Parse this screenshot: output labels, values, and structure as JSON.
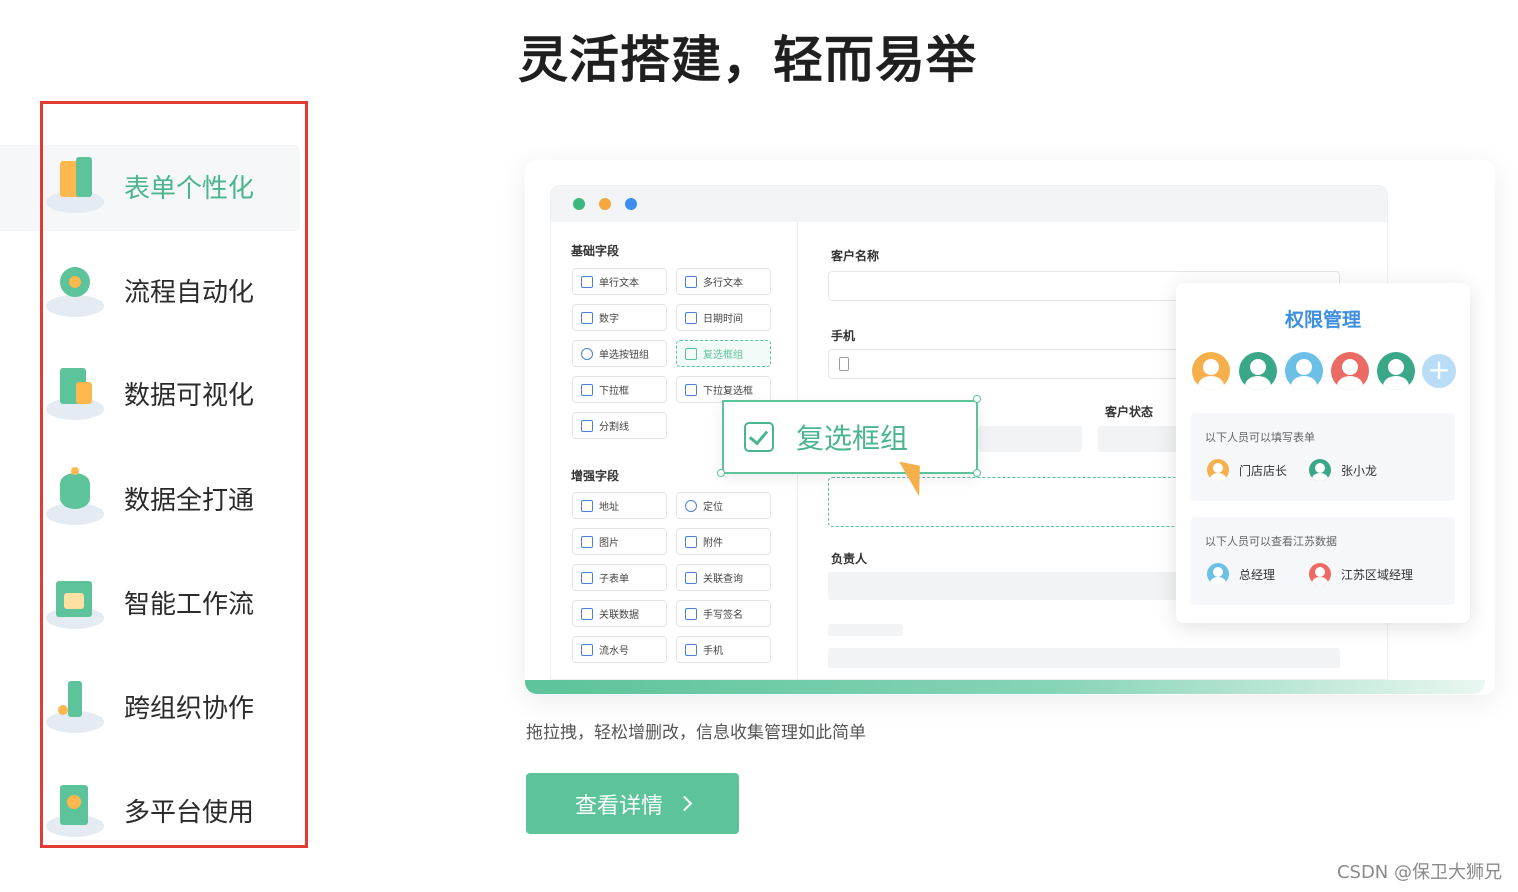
{
  "headline": "灵活搭建，轻而易举",
  "menu": {
    "items": [
      {
        "label": "表单个性化",
        "icon": "form-icon",
        "active": true
      },
      {
        "label": "流程自动化",
        "icon": "flow-icon"
      },
      {
        "label": "数据可视化",
        "icon": "chart-icon"
      },
      {
        "label": "数据全打通",
        "icon": "database-icon"
      },
      {
        "label": "智能工作流",
        "icon": "workflow-icon"
      },
      {
        "label": "跨组织协作",
        "icon": "collaboration-icon"
      },
      {
        "label": "多平台使用",
        "icon": "multi-platform-icon"
      }
    ]
  },
  "mockup": {
    "window_dots": [
      "#3cb881",
      "#f3a73f",
      "#3e8ef0"
    ],
    "basic_fields_title": "基础字段",
    "basic_fields": [
      "单行文本",
      "多行文本",
      "数字",
      "日期时间",
      "单选按钮组",
      "复选框组",
      "下拉框",
      "下拉复选框",
      "分割线"
    ],
    "enhanced_fields_title": "增强字段",
    "enhanced_fields": [
      "地址",
      "定位",
      "图片",
      "附件",
      "子表单",
      "关联查询",
      "关联数据",
      "手写签名",
      "流水号",
      "手机"
    ],
    "form": {
      "customer_name_label": "客户名称",
      "phone_label": "手机",
      "customer_status_label": "客户状态",
      "owner_label": "负责人"
    },
    "drag_item": "复选框组",
    "permission": {
      "title": "权限管理",
      "avatar_colors": [
        "#f5b04c",
        "#3aa888",
        "#6cc0e8",
        "#ec6a64",
        "#3aa888"
      ],
      "block1_note": "以下人员可以填写表单",
      "block1_people": [
        {
          "name": "门店店长",
          "color": "#f5b04c"
        },
        {
          "name": "张小龙",
          "color": "#3aa888"
        }
      ],
      "block2_note": "以下人员可以查看江苏数据",
      "block2_people": [
        {
          "name": "总经理",
          "color": "#6cc0e8"
        },
        {
          "name": "江苏区域经理",
          "color": "#ec6a64"
        }
      ]
    }
  },
  "description": "拖拉拽，轻松增删改，信息收集管理如此简单",
  "detail_button": "查看详情",
  "watermark": "CSDN @保卫大狮兄",
  "accent_color": "#5cc39a"
}
